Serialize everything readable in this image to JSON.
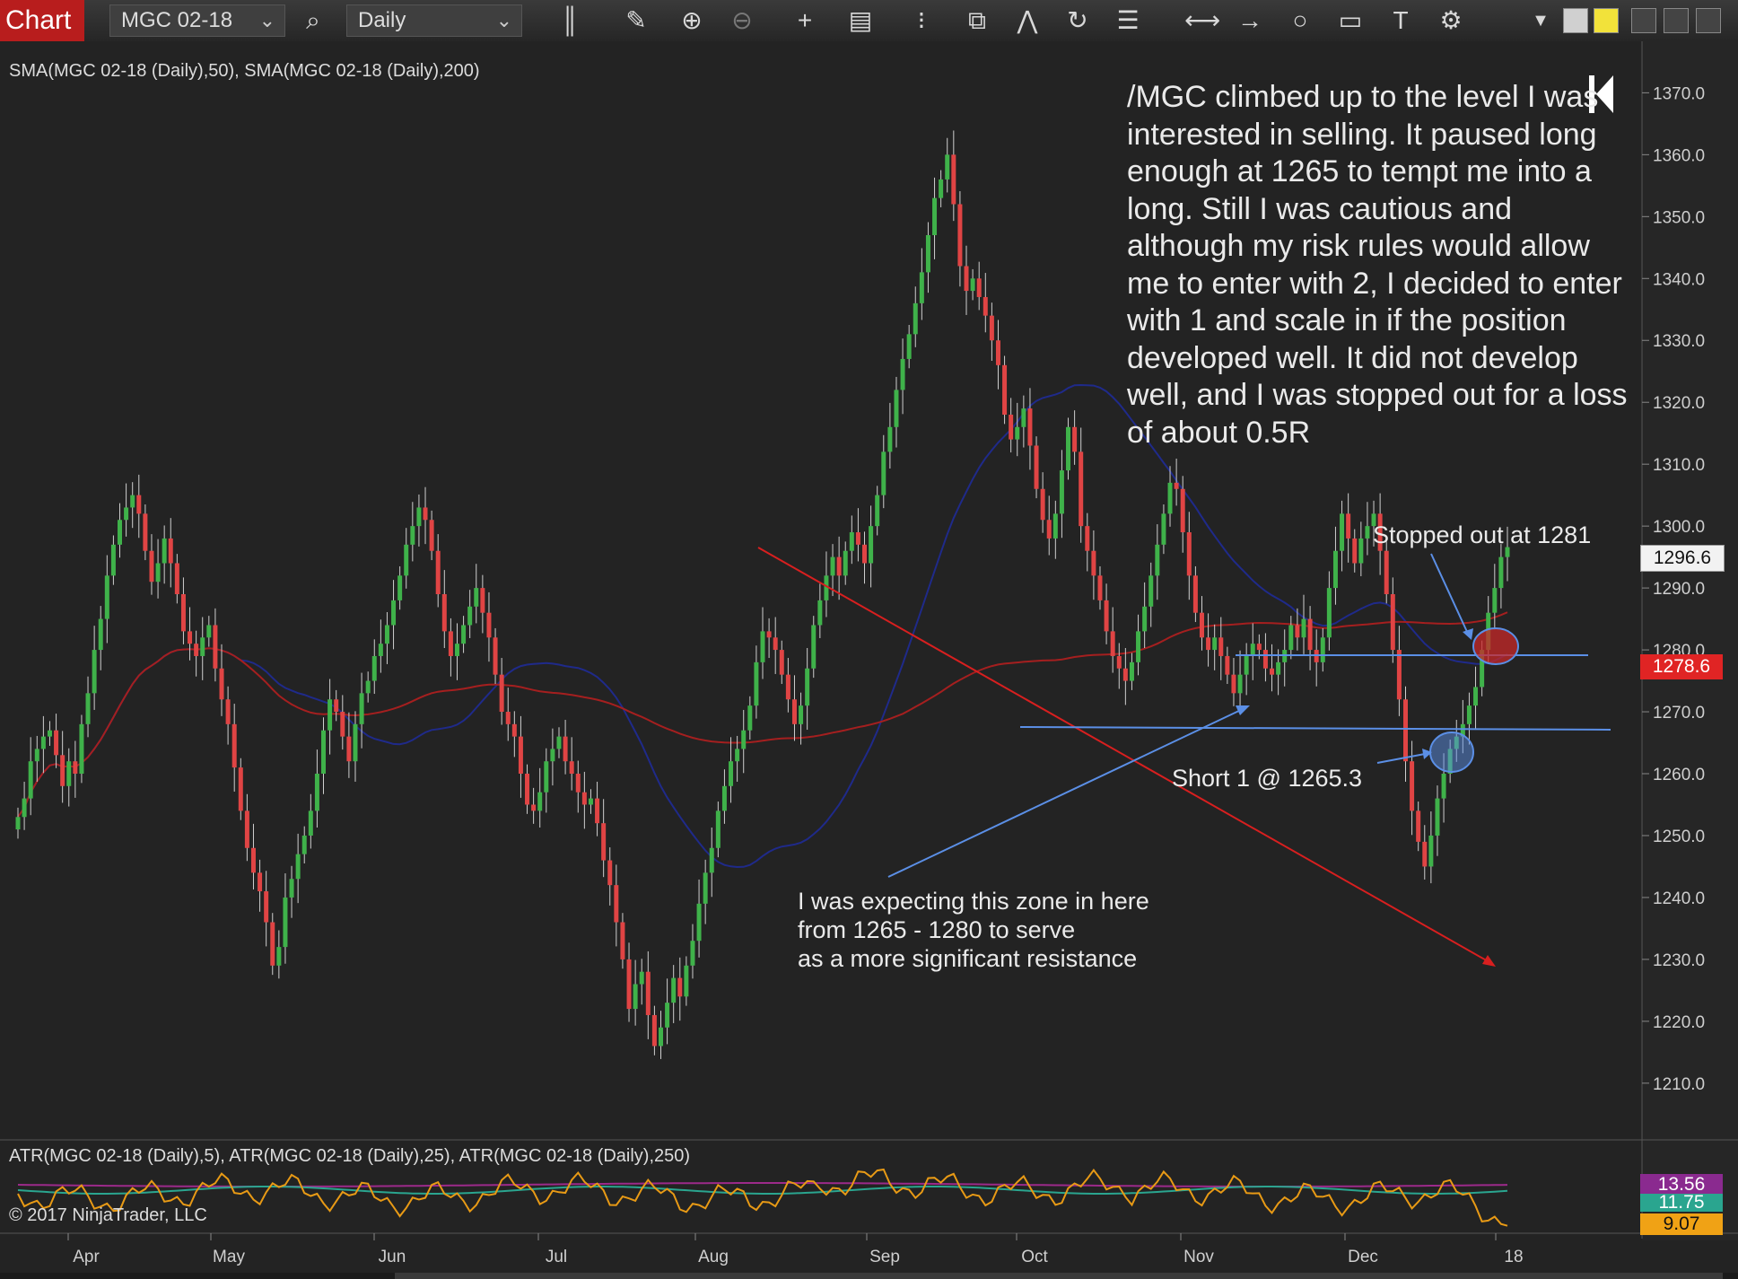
{
  "toolbar": {
    "tab_label": "Chart",
    "instrument": "MGC 02-18",
    "interval": "Daily",
    "icons": [
      "search-icon",
      "bar-chart-icon",
      "pencil-icon",
      "zoom-in-icon",
      "zoom-out-icon",
      "crosshair-icon",
      "data-box-icon",
      "grid-icon",
      "object-tree-icon",
      "drawing-tool-icon",
      "refresh-icon",
      "list-icon",
      "line-icon",
      "arrow-icon",
      "ellipse-icon",
      "rectangle-icon",
      "text-icon",
      "properties-icon",
      "dropdown-icon"
    ]
  },
  "indicators": {
    "price_label": "SMA(MGC 02-18 (Daily),50), SMA(MGC 02-18 (Daily),200)",
    "atr_label": "ATR(MGC 02-18 (Daily),5), ATR(MGC 02-18 (Daily),25), ATR(MGC 02-18 (Daily),250)",
    "copyright": "© 2017 NinjaTrader, LLC"
  },
  "annotations": {
    "main": "/MGC climbed up to the level I was interested in selling. It paused long enough at 1265 to tempt me into a long. Still I was cautious and although my risk rules would allow me to enter with 2, I decided to enter with 1 and scale in if the position developed well.  It did not develop well, and I was stopped out for a loss of about 0.5R",
    "stopped": "Stopped out at 1281",
    "short": "Short 1 @ 1265.3",
    "zone_line1": "I was expecting this zone in here",
    "zone_line2": "from 1265 - 1280 to serve",
    "zone_line3": "as a more significant resistance"
  },
  "badges": {
    "last_price": "1296.6",
    "sma_value": "1278.6",
    "atr5": "13.56",
    "atr25": "11.75",
    "atr250": "9.07"
  },
  "colors": {
    "up_candle": "#3fb24a",
    "down_candle": "#e04444",
    "sma50": "#1f2a8a",
    "sma200": "#a51f1f",
    "annotation_line": "#5b8fe6",
    "trend_line": "#d81f1f",
    "atr5": "#e89a15",
    "atr25": "#2aa58f",
    "atr250": "#9c2a8a"
  },
  "chart_data": {
    "type": "candlestick",
    "price_ylim": [
      1202,
      1376
    ],
    "price_ticks": [
      "1370.0",
      "1360.0",
      "1350.0",
      "1340.0",
      "1330.0",
      "1320.0",
      "1310.0",
      "1300.0",
      "1290.0",
      "1280.0",
      "1270.0",
      "1260.0",
      "1250.0",
      "1240.0",
      "1230.0",
      "1220.0",
      "1210.0"
    ],
    "time_labels": [
      "Apr",
      "May",
      "Jun",
      "Jul",
      "Aug",
      "Sep",
      "Oct",
      "Nov",
      "Dec",
      "18"
    ],
    "closes": [
      1253,
      1256,
      1262,
      1264,
      1266,
      1267,
      1263,
      1258,
      1262,
      1260,
      1268,
      1273,
      1280,
      1285,
      1292,
      1297,
      1301,
      1303,
      1305,
      1302,
      1296,
      1291,
      1294,
      1298,
      1294,
      1289,
      1283,
      1281,
      1279,
      1282,
      1284,
      1277,
      1272,
      1268,
      1261,
      1254,
      1248,
      1244,
      1241,
      1236,
      1229,
      1232,
      1240,
      1243,
      1247,
      1250,
      1254,
      1260,
      1267,
      1272,
      1270,
      1266,
      1262,
      1268,
      1273,
      1275,
      1279,
      1281,
      1284,
      1288,
      1292,
      1297,
      1300,
      1303,
      1301,
      1296,
      1289,
      1283,
      1279,
      1281,
      1284,
      1287,
      1290,
      1286,
      1282,
      1276,
      1270,
      1268,
      1266,
      1260,
      1255,
      1254,
      1257,
      1262,
      1264,
      1266,
      1262,
      1260,
      1257,
      1255,
      1256,
      1252,
      1246,
      1242,
      1236,
      1230,
      1222,
      1226,
      1228,
      1221,
      1216,
      1219,
      1223,
      1227,
      1224,
      1229,
      1233,
      1239,
      1244,
      1248,
      1254,
      1258,
      1262,
      1264,
      1267,
      1271,
      1278,
      1283,
      1282,
      1280,
      1276,
      1272,
      1268,
      1271,
      1277,
      1284,
      1288,
      1292,
      1295,
      1292,
      1296,
      1299,
      1297,
      1294,
      1300,
      1305,
      1312,
      1316,
      1322,
      1327,
      1331,
      1336,
      1341,
      1347,
      1353,
      1356,
      1360,
      1352,
      1342,
      1338,
      1340,
      1337,
      1334,
      1330,
      1326,
      1318,
      1314,
      1316,
      1319,
      1313,
      1306,
      1301,
      1298,
      1302,
      1309,
      1316,
      1312,
      1300,
      1296,
      1292,
      1288,
      1283,
      1279,
      1277,
      1275,
      1278,
      1283,
      1287,
      1292,
      1297,
      1302,
      1307,
      1306,
      1299,
      1292,
      1286,
      1282,
      1280,
      1282,
      1279,
      1276,
      1273,
      1276,
      1279,
      1281,
      1280,
      1277,
      1276,
      1278,
      1280,
      1284,
      1282,
      1285,
      1280,
      1278,
      1282,
      1290,
      1296,
      1302,
      1298,
      1294,
      1298,
      1300,
      1302,
      1296,
      1289,
      1280,
      1272,
      1262,
      1254,
      1249,
      1245,
      1250,
      1256,
      1260,
      1264,
      1266,
      1268,
      1271,
      1274,
      1280,
      1286,
      1290,
      1295,
      1296.6
    ],
    "sma50_series": "blue moving average",
    "sma200_series": "red moving average"
  }
}
